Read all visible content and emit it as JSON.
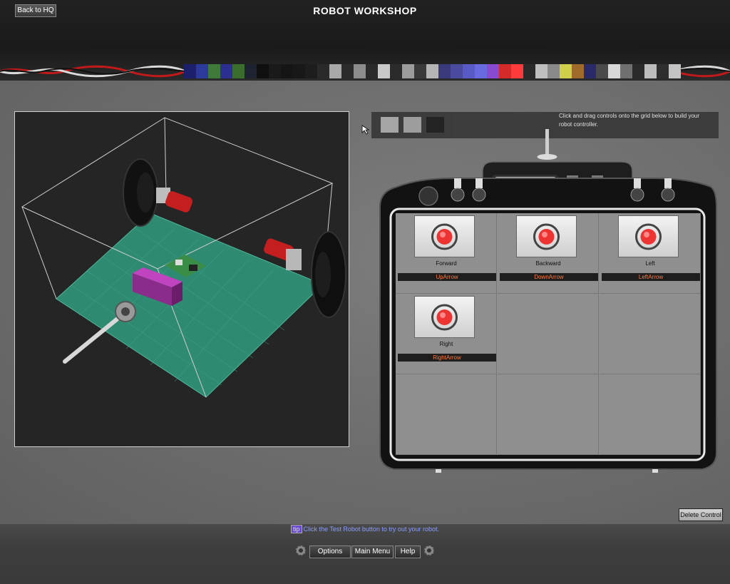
{
  "header": {
    "back_label": "Back to HQ",
    "title": "ROBOT WORKSHOP"
  },
  "palette": {
    "swatches": [
      "#1c1f6b",
      "#1c1f6b",
      "#2c3a9c",
      "#2c3a9c",
      "#3f7a3a",
      "#3f7a3a",
      "#2c2f8f",
      "#2c2f8f",
      "#3b6e2e",
      "#3b6e2e",
      "#1f2230",
      "#1f2230",
      "#0f0f0f",
      "#0f0f0f",
      "#1a1a1a",
      "#1a1a1a",
      "#151515",
      "#151515",
      "#181818",
      "#181818",
      "#1d1d1d",
      "#1d1d1d",
      "#2a2a2a",
      "#2a2a2a",
      "#a8a8a8",
      "#a8a8a8",
      "#2b2b2b",
      "#2b2b2b",
      "#8c8c8c",
      "#8c8c8c",
      "#2a2a2a",
      "#2a2a2a",
      "#c9c9c9",
      "#c9c9c9",
      "#2b2b2b",
      "#2b2b2b",
      "#9c9c9c",
      "#9c9c9c",
      "#3a3a3a",
      "#3a3a3a",
      "#b5b5b5",
      "#b5b5b5",
      "#3a3a7a",
      "#3a3a7a",
      "#4a4aa0",
      "#4a4aa0",
      "#5a5ac6",
      "#5a5ac6",
      "#6a6ae0",
      "#6a6ae0",
      "#8a4ad0",
      "#8a4ad0",
      "#d42a2a",
      "#d42a2a",
      "#ff3a3a",
      "#ff3a3a",
      "#2a2a2a",
      "#2a2a2a",
      "#bfbfbf",
      "#bfbfbf",
      "#8a8a8a",
      "#8a8a8a",
      "#cfcf4a",
      "#cfcf4a",
      "#a06a2a",
      "#a06a2a",
      "#2a2a6a",
      "#2a2a6a",
      "#4a4a4a",
      "#4a4a4a",
      "#d9d9d9",
      "#d9d9d9",
      "#707070",
      "#707070",
      "#2a2a2a",
      "#2a2a2a",
      "#bcbcbc",
      "#bcbcbc",
      "#2e2e2e",
      "#2e2e2e",
      "#c4c4c4",
      "#c4c4c4"
    ]
  },
  "toolbar": {
    "hint": "Click and drag controls onto the grid below to build your robot controller.",
    "tools": [
      {
        "name": "tool-large-button",
        "color": "#a8a8a8"
      },
      {
        "name": "tool-small-button",
        "color": "#a0a0a0"
      },
      {
        "name": "tool-blank",
        "color": "#1f1f1f"
      }
    ]
  },
  "controls": [
    {
      "label": "Forward",
      "key": "UpArrow"
    },
    {
      "label": "Backward",
      "key": "DownArrow"
    },
    {
      "label": "Left",
      "key": "LeftArrow"
    },
    {
      "label": "Right",
      "key": "RightArrow"
    }
  ],
  "delete_label": "Delete Control",
  "tip": {
    "badge": "tip",
    "text": "Click the Test Robot button to try out your robot."
  },
  "footer": {
    "options_label": "Options",
    "main_menu_label": "Main Menu",
    "help_label": "Help"
  },
  "colors": {
    "accent_key": "#ff7a3c",
    "tip_text": "#8a9cff",
    "robot_floor": "#2f8a72"
  }
}
